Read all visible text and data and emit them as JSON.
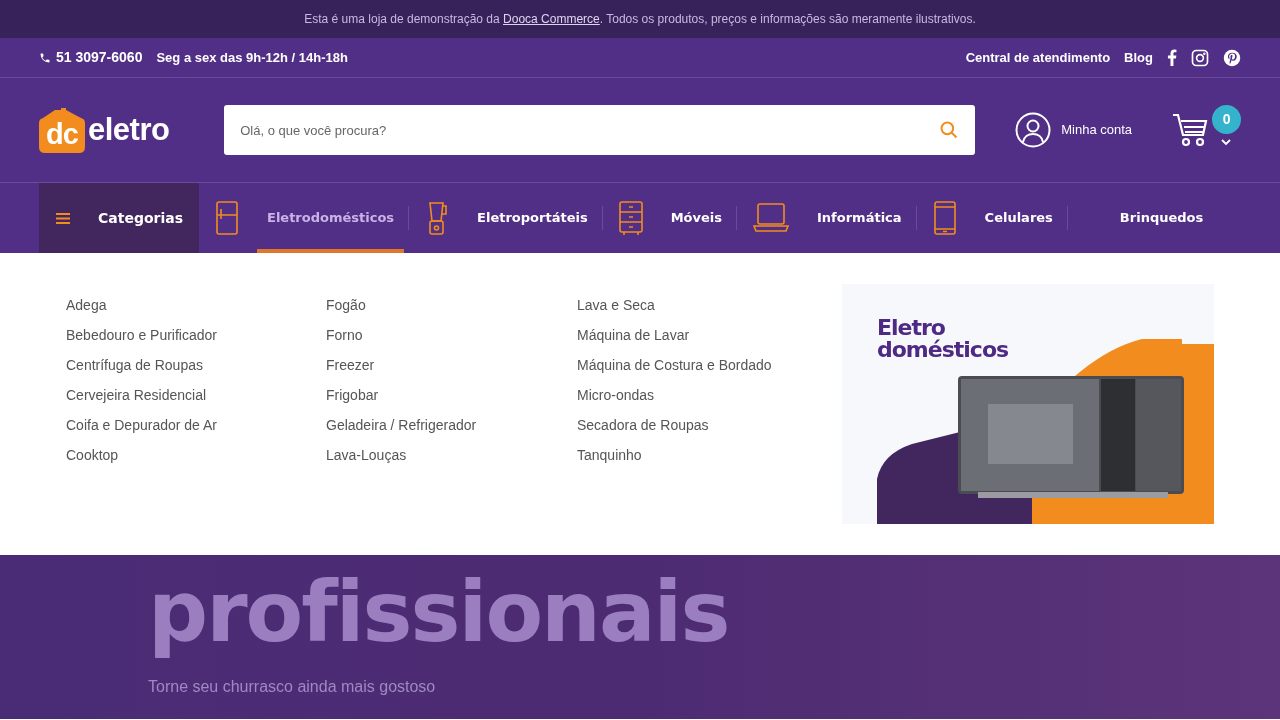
{
  "notice": {
    "text": "Esta é uma loja de demonstração da ",
    "link": "Dooca Commerce",
    "rest": ". Todos os produtos, preços e informações são meramente ilustrativos."
  },
  "topbar": {
    "phone": "51 3097-6060",
    "hours": "Seg a sex das 9h-12h / 14h-18h",
    "links": [
      "Central de atendimento",
      "Blog"
    ]
  },
  "logo": {
    "badge": "dc",
    "text": "eletro"
  },
  "search": {
    "placeholder": "Olá, o que você procura?"
  },
  "account": {
    "label": "Minha conta"
  },
  "cart": {
    "count": "0"
  },
  "nav": {
    "categories": "Categorias",
    "items": [
      {
        "label": "Eletrodomésticos",
        "kind": "fridge",
        "selected": true
      },
      {
        "label": "Eletroportáteis",
        "kind": "blender",
        "selected": false
      },
      {
        "label": "Móveis",
        "kind": "drawers",
        "selected": false
      },
      {
        "label": "Informática",
        "kind": "laptop",
        "selected": false
      },
      {
        "label": "Celulares",
        "kind": "phone",
        "selected": false
      },
      {
        "label": "Brinquedos",
        "kind": "none",
        "selected": false
      }
    ]
  },
  "menu": {
    "columns": [
      [
        "Adega",
        "Bebedouro e Purificador",
        "Centrífuga de Roupas",
        "Cervejeira Residencial",
        "Coifa e Depurador de Ar",
        "Cooktop"
      ],
      [
        "Fogão",
        "Forno",
        "Freezer",
        "Frigobar",
        "Geladeira / Refrigerador",
        "Lava-Louças"
      ],
      [
        "Lava e Seca",
        "Máquina de Lavar",
        "Máquina de Costura e Bordado",
        "Micro-ondas",
        "Secadora de Roupas",
        "Tanquinho"
      ]
    ],
    "banner": {
      "line1": "Eletro",
      "line2": "domésticos"
    }
  },
  "hero": {
    "title": "profissionais",
    "subtitle": "Torne seu churrasco ainda mais gostoso"
  }
}
